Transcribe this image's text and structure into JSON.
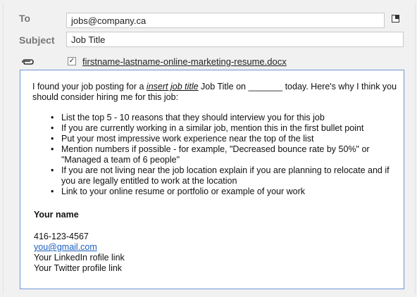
{
  "to": {
    "label": "To",
    "value": "jobs@company.ca"
  },
  "subject": {
    "label": "Subject",
    "value": "Job Title"
  },
  "attachment": {
    "checked": "✓",
    "filename": "firstname-lastname-online-marketing-resume.docx"
  },
  "body": {
    "intro_1": "I found your job posting for a ",
    "intro_em": "insert job title",
    "intro_2": " Job Title on _______ today. Here's why I think you should consider hiring me for this job:",
    "points": [
      "List the top 5 - 10 reasons that they should interview you for this job",
      "If you are currently working in a similar job, mention this in the first bullet point",
      "Put your most impressive work experience near the top of the list",
      "Mention numbers if possible - for example, \"Decreased bounce rate by 50%\" or \"Managed a team of 6 people\"",
      "If you are not living near the job location explain if you are planning to relocate and if you are legally entitled to work at the location",
      "Link to your online resume or portfolio or example of your work"
    ],
    "signature": {
      "name": "Your name",
      "phone": "416-123-4567",
      "email": "you@gmail.com",
      "linkedin": "Your LinkedIn rofile link",
      "twitter": "Your Twitter profile link"
    }
  },
  "icons": {
    "popout": "popout-icon",
    "attachment": "paperclip-icon"
  },
  "colors": {
    "body_border": "#6d95d2",
    "link": "#1a5fc0",
    "label": "#777777"
  }
}
